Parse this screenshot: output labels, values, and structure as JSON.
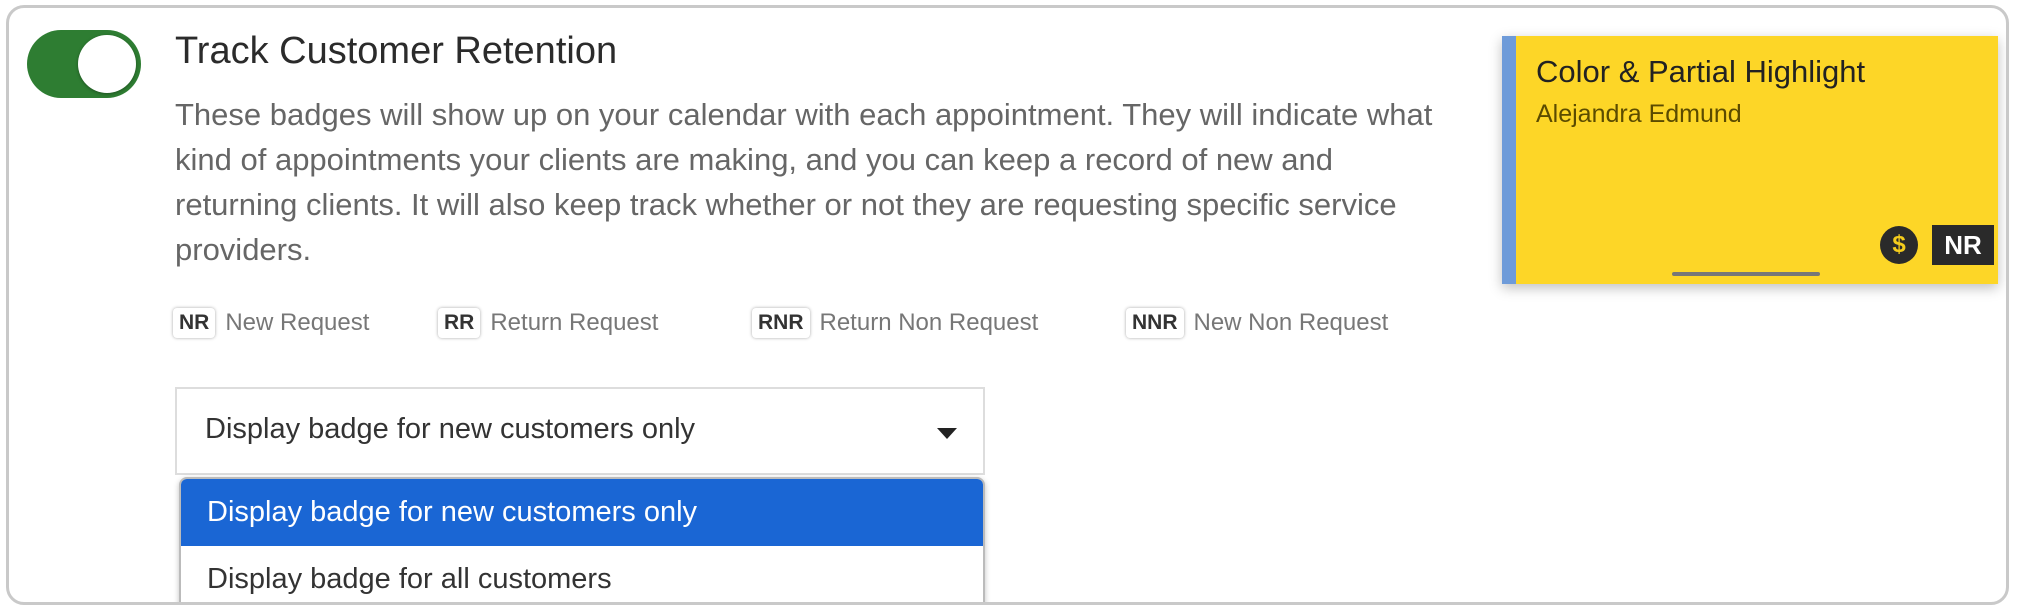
{
  "colors": {
    "toggle_on": "#2e7d32",
    "accent_blue": "#1a66d4",
    "card_bg": "#fdd627",
    "card_stripe": "#6e9bd9",
    "badge_dark": "#2a2a2a"
  },
  "toggle": {
    "state": "on"
  },
  "header": {
    "title": "Track Customer Retention"
  },
  "description": "These badges will show up on your calendar with each appointment. They will indicate what kind of appointments your clients are making, and you can keep a record of new and returning clients. It will also keep track whether or not they are requesting specific service providers.",
  "legend": [
    {
      "code": "NR",
      "label": "New Request"
    },
    {
      "code": "RR",
      "label": "Return Request"
    },
    {
      "code": "RNR",
      "label": "Return Non Request"
    },
    {
      "code": "NNR",
      "label": "New Non Request"
    }
  ],
  "select": {
    "value": "Display badge for new customers only",
    "options": [
      "Display badge for new customers only",
      "Display badge for all customers"
    ],
    "selected_index": 0
  },
  "card": {
    "title": "Color & Partial Highlight",
    "client": "Alejandra Edmund",
    "icon": "dollar-icon",
    "badge": "NR"
  }
}
